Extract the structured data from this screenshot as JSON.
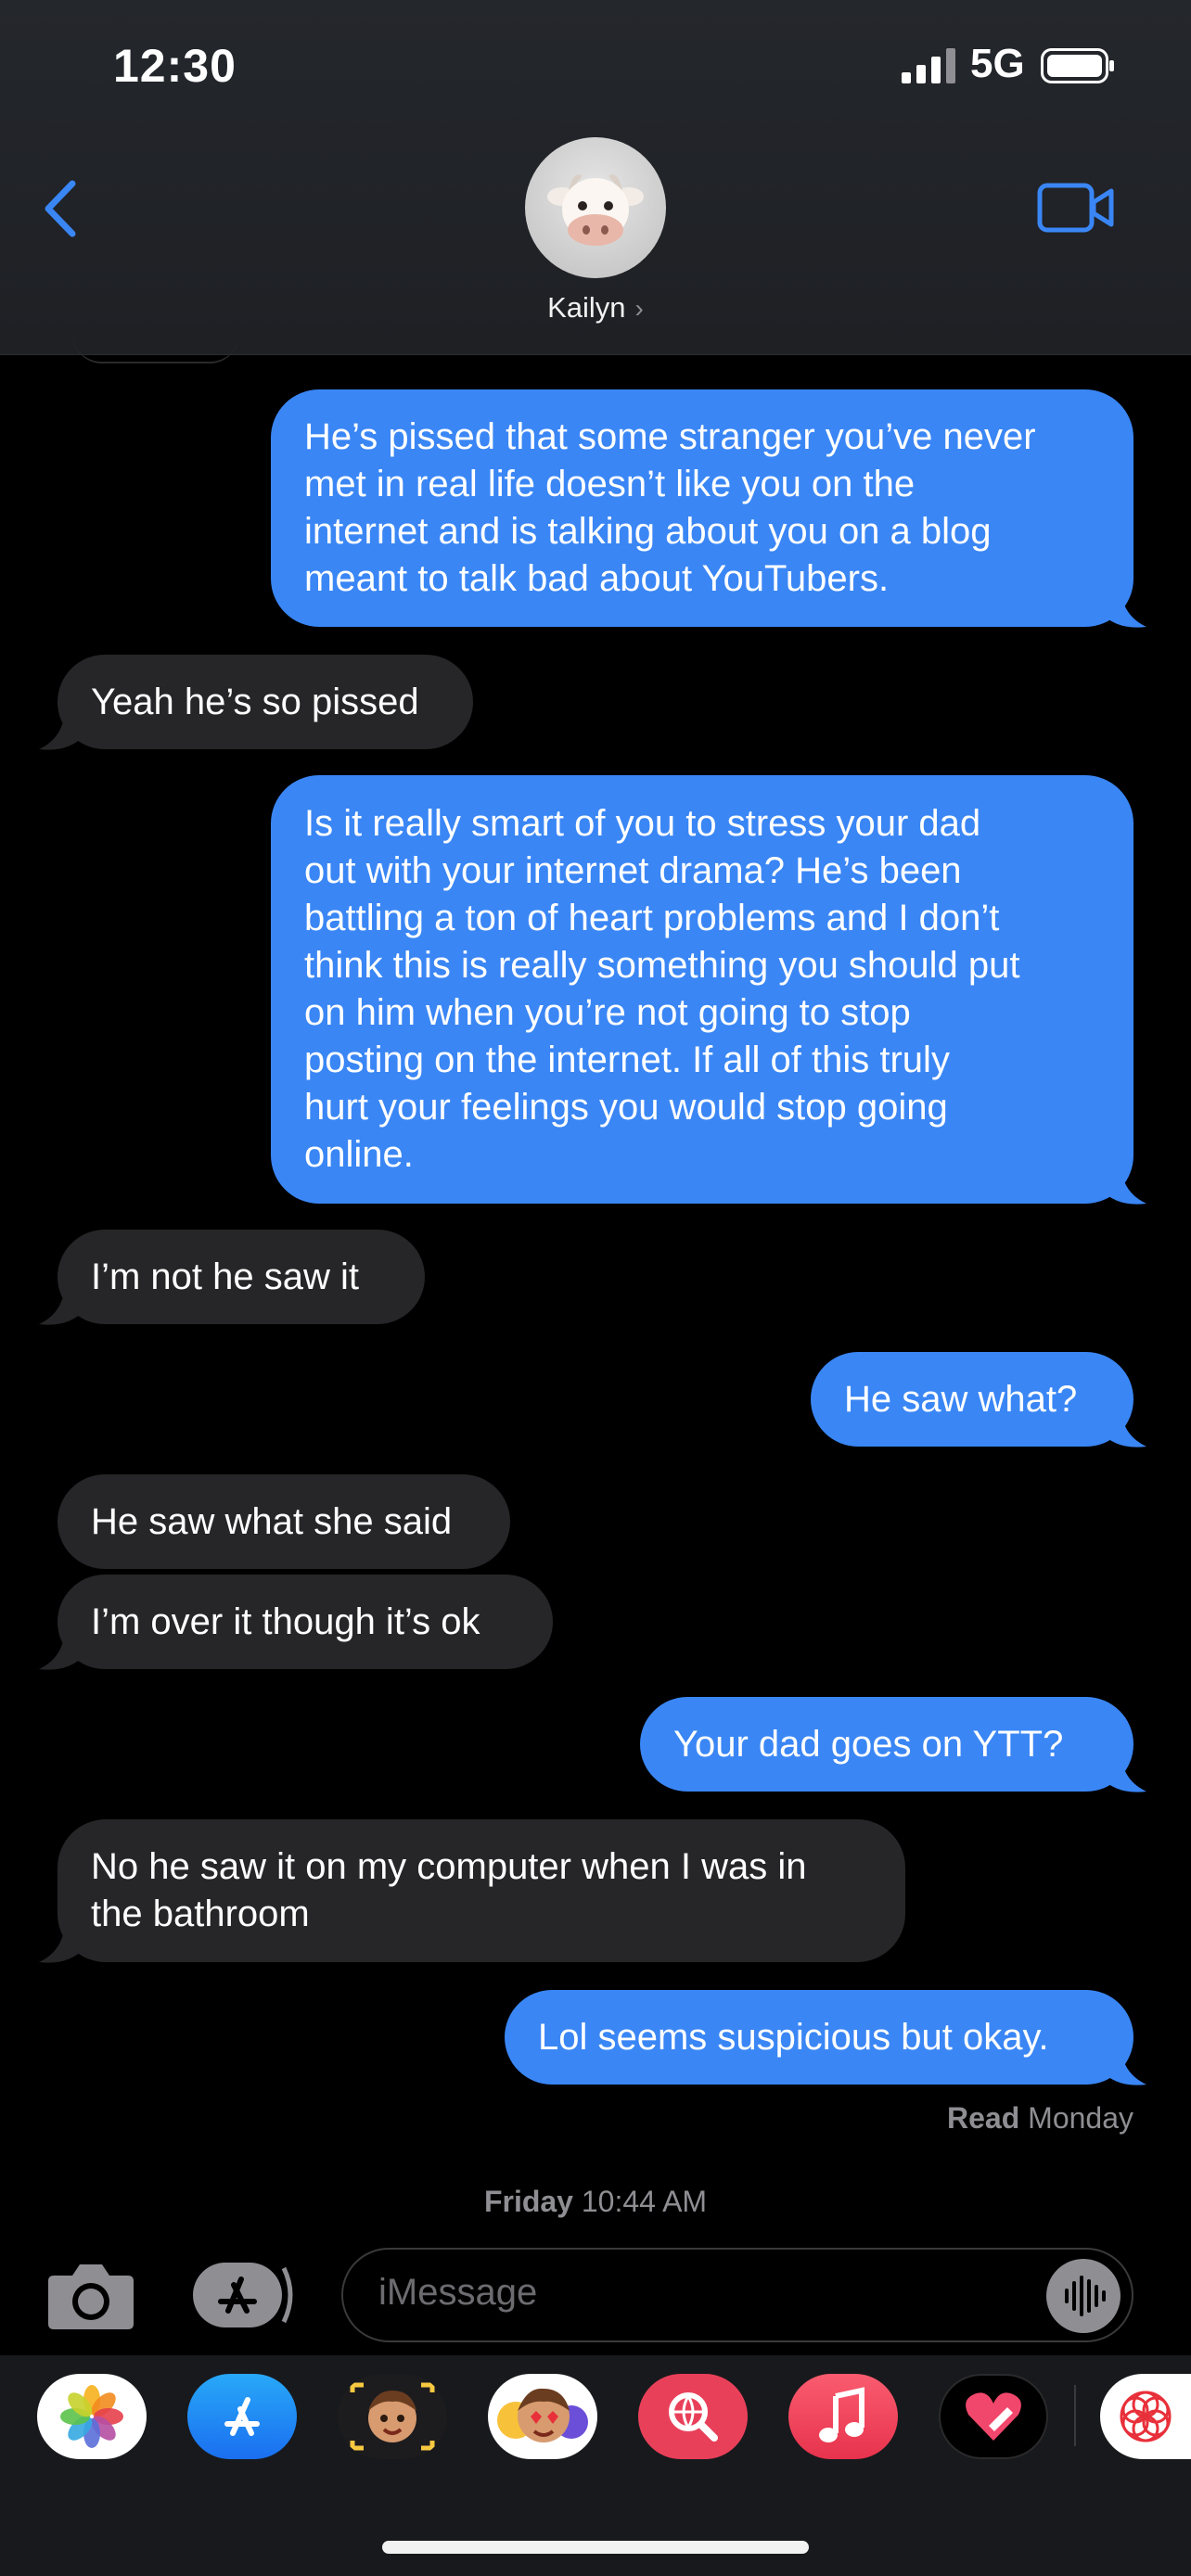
{
  "status_bar": {
    "time": "12:30",
    "network": "5G",
    "signal_bars": 4,
    "battery_level": 0.95
  },
  "header": {
    "contact_name": "Kailyn",
    "back_icon": "chevron-left-icon",
    "video_icon": "video-camera-icon",
    "avatar_icon": "cow-memoji-icon",
    "accent_color": "#3a86f5"
  },
  "messages": [
    {
      "direction": "outgoing",
      "text": "He’s pissed that some stranger you’ve never\nmet in real life doesn’t like you on the\ninternet and is talking about you on a blog\nmeant to talk bad about YouTubers."
    },
    {
      "direction": "incoming",
      "text": "Yeah he’s so pissed"
    },
    {
      "direction": "outgoing",
      "text": "Is it really smart of you to stress your dad\nout with your internet drama? He’s been\nbattling a ton of heart problems and I don’t\nthink this is really something you should put\non him when you’re not going to stop\nposting on the internet. If all of this truly\nhurt your feelings you would stop going\nonline."
    },
    {
      "direction": "incoming",
      "text": "I’m not he saw it"
    },
    {
      "direction": "outgoing",
      "text": "He saw what?"
    },
    {
      "direction": "incoming",
      "text": "He saw what she said"
    },
    {
      "direction": "incoming",
      "text": "I’m over it though it’s ok"
    },
    {
      "direction": "outgoing",
      "text": "Your dad goes on YTT?"
    },
    {
      "direction": "incoming",
      "text": "No he saw it on my computer when I was in\nthe bathroom"
    },
    {
      "direction": "outgoing",
      "text": "Lol seems suspicious but okay."
    }
  ],
  "read_receipt": {
    "label": "Read",
    "day": "Monday"
  },
  "next_timestamp": {
    "day": "Friday",
    "time": "10:44 AM"
  },
  "compose": {
    "placeholder": "iMessage",
    "camera_icon": "camera-icon",
    "apps_icon": "app-store-icon",
    "audio_icon": "audio-waveform-icon"
  },
  "app_drawer": [
    {
      "name": "photos-app-icon",
      "color": "#ffffff"
    },
    {
      "name": "app-store-app-icon",
      "color": "#1e8ef5"
    },
    {
      "name": "memoji-app-icon",
      "color": "#1c1c1e"
    },
    {
      "name": "memoji-stickers-app-icon",
      "color": "#ffffff"
    },
    {
      "name": "web-search-app-icon",
      "color": "#e9405a"
    },
    {
      "name": "music-app-icon",
      "color": "#f0415a"
    },
    {
      "name": "digital-touch-app-icon",
      "color": "#000000"
    },
    {
      "name": "mandala-app-icon",
      "color": "#ffffff"
    }
  ]
}
